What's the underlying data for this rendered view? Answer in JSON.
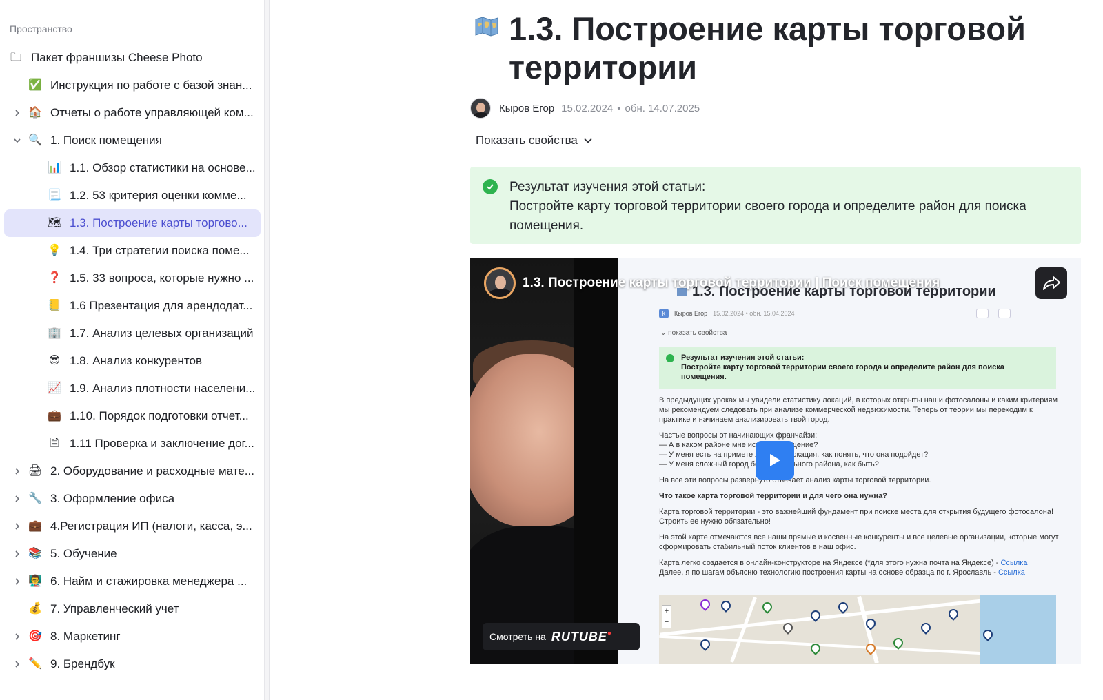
{
  "sidebar": {
    "space_label": "Пространство",
    "items": [
      {
        "label": "Пакет франшизы Cheese Photo",
        "emoji": "🗀",
        "level": 0,
        "chevron": "none"
      },
      {
        "label": "Инструкция по работе с базой знан...",
        "emoji": "✅",
        "level": 1,
        "chevron": "none"
      },
      {
        "label": "Отчеты о работе управляющей ком...",
        "emoji": "🏠",
        "level": 1,
        "chevron": "right"
      },
      {
        "label": "1. Поиск помещения",
        "emoji": "🔍",
        "level": 1,
        "chevron": "down"
      },
      {
        "label": "1.1. Обзор статистики на основе...",
        "emoji": "📊",
        "level": 2,
        "chevron": "none"
      },
      {
        "label": "1.2. 53 критерия оценки комме...",
        "emoji": "📃",
        "level": 2,
        "chevron": "none"
      },
      {
        "label": "1.3. Построение карты торгово...",
        "emoji": "🗺",
        "level": 2,
        "chevron": "none",
        "active": true
      },
      {
        "label": "1.4. Три стратегии поиска поме...",
        "emoji": "💡",
        "level": 2,
        "chevron": "none"
      },
      {
        "label": "1.5. 33 вопроса, которые нужно ...",
        "emoji": "❓",
        "level": 2,
        "chevron": "none"
      },
      {
        "label": "1.6 Презентация для арендодат...",
        "emoji": "📒",
        "level": 2,
        "chevron": "none"
      },
      {
        "label": "1.7. Анализ целевых организаций",
        "emoji": "🏢",
        "level": 2,
        "chevron": "none"
      },
      {
        "label": "1.8. Анализ конкурентов",
        "emoji": "😎",
        "level": 2,
        "chevron": "none"
      },
      {
        "label": "1.9. Анализ плотности населени...",
        "emoji": "📈",
        "level": 2,
        "chevron": "none"
      },
      {
        "label": "1.10. Порядок подготовки отчет...",
        "emoji": "💼",
        "level": 2,
        "chevron": "none"
      },
      {
        "label": "1.11 Проверка и заключение дог...",
        "emoji": "🗎",
        "level": 2,
        "chevron": "none"
      },
      {
        "label": "2. Оборудование и расходные мате...",
        "emoji": "🖨",
        "level": 1,
        "chevron": "right"
      },
      {
        "label": "3. Оформление офиса",
        "emoji": "🔧",
        "level": 1,
        "chevron": "right"
      },
      {
        "label": "4.Регистрация ИП (налоги, касса, э...",
        "emoji": "💼",
        "level": 1,
        "chevron": "right"
      },
      {
        "label": "5. Обучение",
        "emoji": "📚",
        "level": 1,
        "chevron": "right"
      },
      {
        "label": "6. Найм и стажировка менеджера ...",
        "emoji": "👨‍🏫",
        "level": 1,
        "chevron": "right"
      },
      {
        "label": "7. Управленческий учет",
        "emoji": "💰",
        "level": 1,
        "chevron": "none"
      },
      {
        "label": "8. Маркетинг",
        "emoji": "🎯",
        "level": 1,
        "chevron": "right"
      },
      {
        "label": "9. Брендбук",
        "emoji": "✏️",
        "level": 1,
        "chevron": "right"
      }
    ]
  },
  "article": {
    "title": "1.3. Построение карты торговой территории",
    "author": "Кыров Егор",
    "created": "15.02.2024",
    "updated": "обн. 14.07.2025",
    "show_props": "Показать свойства",
    "callout_heading": "Результат изучения этой статьи:",
    "callout_body": "Постройте карту торговой территории своего города и определите район для поиска помещения."
  },
  "video": {
    "title": "1.3. Построение карты торговой территории | Поиск помещения",
    "watch_on": "Смотреть на",
    "brand": "RUTUBE",
    "shot": {
      "title": "1.3. Построение карты торговой территории",
      "author": "Кыров Егор",
      "avatar_letter": "К",
      "dates": "15.02.2024 • обн. 15.04.2024",
      "props": "⌄ показать свойства",
      "callout": "Результат изучения этой статьи:\nПостройте карту торговой территории своего города и определите район для поиска помещения.",
      "p1": "В предыдущих уроках мы увидели статистику локаций, в которых открыты наши фотосалоны и каким критериям мы рекомендуем следовать при анализе коммерческой недвижимости.  Теперь от теории мы переходим к практике и начинаем анализировать твой город.",
      "p2": "Частые вопросы от начинающих франчайзи:\n— А в каком районе мне искать помещение?\n— У меня есть на примете хорошая локация, как понять, что она подойдет?\n— У меня сложный город без центрального района, как быть?",
      "p3": "На все эти вопросы развернуто отвечает анализ карты торговой территории.",
      "p4": "Что такое карта торговой территории и для чего она нужна?",
      "p5": "Карта торговой территории - это важнейший фундамент при поиске места для открытия будущего фотосалона! Строить ее нужно обязательно!",
      "p6": "На этой карте отмечаются все наши прямые и косвенные конкуренты и все целевые организации, которые могут сформировать стабильный поток клиентов в наш офис.",
      "p7a": "Карта легко создается в онлайн-конструкторе на Яндексе (*для этого нужна почта на Яндексе) - ",
      "p7b": "Далее, я по шагам объясню технологию построения карты на основе образца по г. Ярославль - ",
      "link": "Ссылка"
    }
  },
  "colors": {
    "accent": "#4c4fd0",
    "active_bg": "#e3e4fb",
    "callout_bg": "#e5f8e7",
    "success": "#2eb34f",
    "play": "#2f7ff2"
  }
}
